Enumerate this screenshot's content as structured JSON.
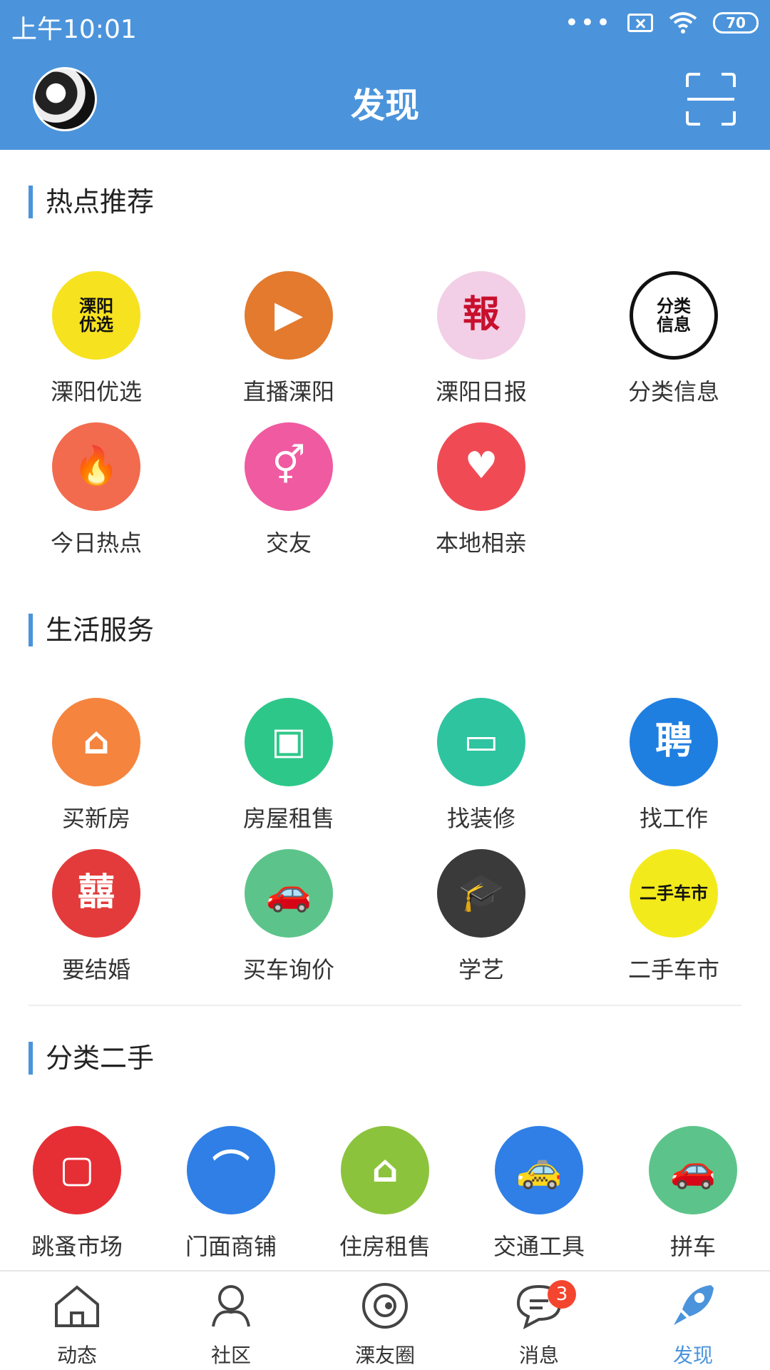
{
  "status": {
    "time": "上午10:01",
    "battery": "70"
  },
  "nav": {
    "title": "发现"
  },
  "sections": [
    {
      "title": "热点推荐",
      "items": [
        {
          "label": "溧阳优选",
          "icon": "liyang-youxuan-icon",
          "color": "#f6e21f",
          "glyph": "溧阳\n优选"
        },
        {
          "label": "直播溧阳",
          "icon": "video-camera-icon",
          "color": "#e37a2e",
          "glyph": "▶"
        },
        {
          "label": "溧阳日报",
          "icon": "newspaper-icon",
          "color": "#f2cfe6",
          "glyph": "報"
        },
        {
          "label": "分类信息",
          "icon": "classified-info-icon",
          "color": "#ffffff",
          "glyph": "分类\n信息"
        },
        {
          "label": "今日热点",
          "icon": "flame-icon",
          "color": "#f26b4e",
          "glyph": "🔥"
        },
        {
          "label": "交友",
          "icon": "gender-icon",
          "color": "#f05aa0",
          "glyph": "⚥"
        },
        {
          "label": "本地相亲",
          "icon": "couple-icon",
          "color": "#f04b55",
          "glyph": "♥"
        }
      ]
    },
    {
      "title": "生活服务",
      "items": [
        {
          "label": "买新房",
          "icon": "house-icon",
          "color": "#f5843f",
          "glyph": "⌂"
        },
        {
          "label": "房屋租售",
          "icon": "building-icon",
          "color": "#2ec78a",
          "glyph": "▣"
        },
        {
          "label": "找装修",
          "icon": "paint-roller-icon",
          "color": "#2ec4a0",
          "glyph": "▭"
        },
        {
          "label": "找工作",
          "icon": "recruit-icon",
          "color": "#1f7fe0",
          "glyph": "聘"
        },
        {
          "label": "要结婚",
          "icon": "wedding-icon",
          "color": "#e33b3b",
          "glyph": "囍"
        },
        {
          "label": "买车询价",
          "icon": "car-icon",
          "color": "#5cc48a",
          "glyph": "🚗"
        },
        {
          "label": "学艺",
          "icon": "graduate-icon",
          "color": "#3a3a3a",
          "glyph": "🎓"
        },
        {
          "label": "二手车市",
          "icon": "used-car-icon",
          "color": "#f3ea1c",
          "glyph": "二手车市"
        }
      ]
    },
    {
      "title": "分类二手",
      "items": [
        {
          "label": "跳蚤市场",
          "icon": "flea-market-icon",
          "color": "#e52f35",
          "glyph": "▢"
        },
        {
          "label": "门面商铺",
          "icon": "storefront-icon",
          "color": "#2f7fe6",
          "glyph": "⌒"
        },
        {
          "label": "住房租售",
          "icon": "house-key-icon",
          "color": "#8cc33c",
          "glyph": "⌂"
        },
        {
          "label": "交通工具",
          "icon": "taxi-icon",
          "color": "#2f7fe6",
          "glyph": "🚕"
        },
        {
          "label": "拼车",
          "icon": "carpool-icon",
          "color": "#5cc48a",
          "glyph": "🚗"
        }
      ]
    }
  ],
  "tabs": [
    {
      "label": "动态",
      "icon": "home-icon"
    },
    {
      "label": "社区",
      "icon": "community-icon"
    },
    {
      "label": "溧友圈",
      "icon": "circle-icon"
    },
    {
      "label": "消息",
      "icon": "message-icon",
      "badge": "3"
    },
    {
      "label": "发现",
      "icon": "rocket-icon",
      "active": true
    }
  ],
  "colors": {
    "accent": "#4b94dc"
  }
}
